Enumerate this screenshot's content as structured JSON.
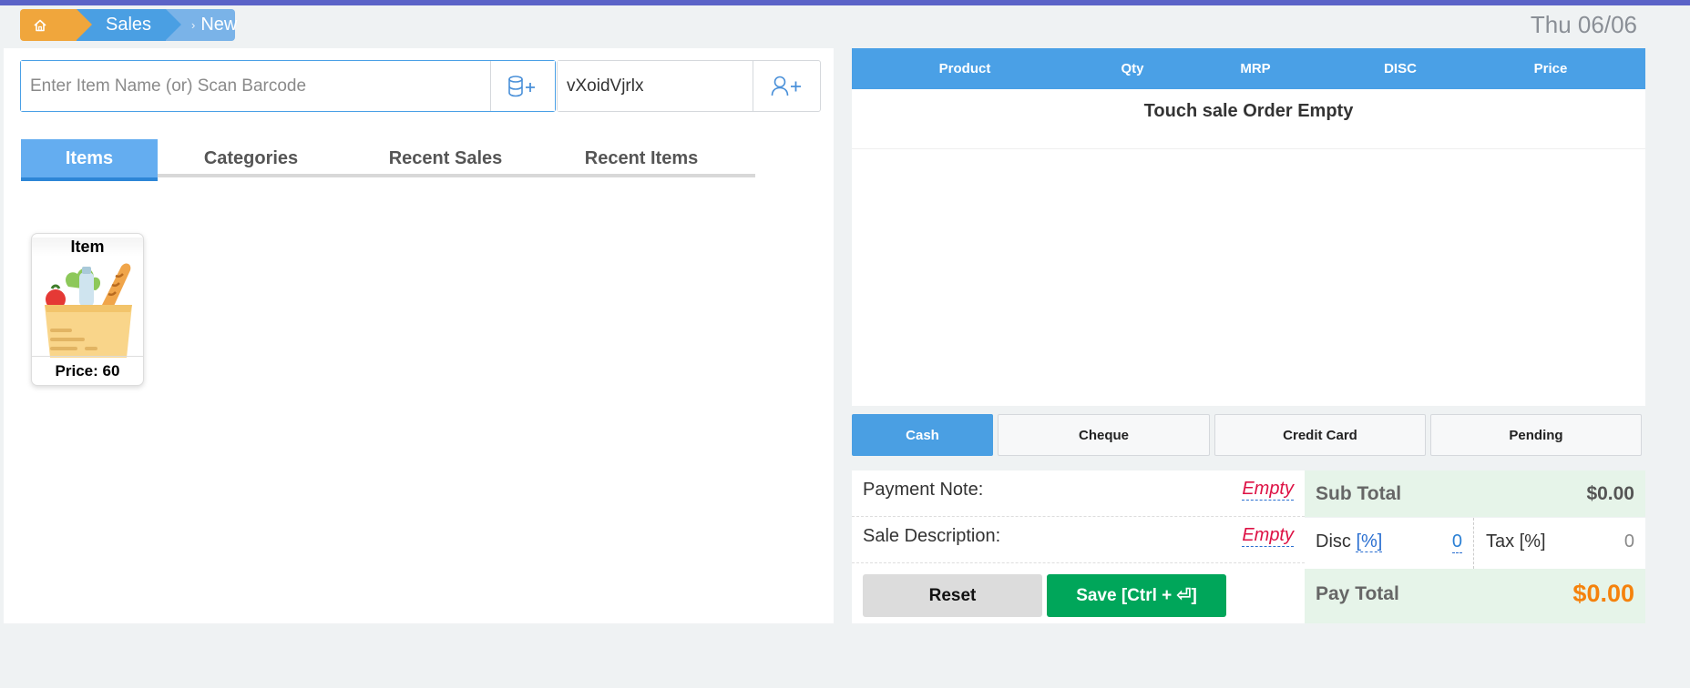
{
  "breadcrumb": {
    "sales": "Sales",
    "new": "New"
  },
  "header": {
    "date": "Thu 06/06"
  },
  "search": {
    "placeholder": "Enter Item Name (or) Scan Barcode",
    "value": ""
  },
  "customer": {
    "value": "vXoidVjrlx"
  },
  "tabs": [
    {
      "label": "Items",
      "active": true
    },
    {
      "label": "Categories",
      "active": false
    },
    {
      "label": "Recent Sales",
      "active": false
    },
    {
      "label": "Recent Items",
      "active": false
    }
  ],
  "items": [
    {
      "name": "Item",
      "price_label": "Price: 60"
    }
  ],
  "order": {
    "columns": [
      "Product",
      "Qty",
      "MRP",
      "DISC",
      "Price"
    ],
    "empty_message": "Touch sale Order Empty"
  },
  "payment_methods": [
    {
      "label": "Cash",
      "active": true
    },
    {
      "label": "Cheque",
      "active": false
    },
    {
      "label": "Credit Card",
      "active": false
    },
    {
      "label": "Pending",
      "active": false
    }
  ],
  "notes": {
    "payment_note_label": "Payment Note:",
    "payment_note_value": "Empty",
    "sale_description_label": "Sale Description:",
    "sale_description_value": "Empty"
  },
  "actions": {
    "reset": "Reset",
    "save": "Save [Ctrl + ⏎]"
  },
  "totals": {
    "subtotal_label": "Sub Total",
    "subtotal_value": "$0.00",
    "disc_label": "Disc",
    "disc_pct": "[%]",
    "disc_value": "0",
    "tax_label": "Tax [%]",
    "tax_value": "0",
    "paytotal_label": "Pay Total",
    "paytotal_value": "$0.00"
  },
  "colors": {
    "accent": "#4aa0e6",
    "save": "#00a65a",
    "home": "#f0a63c",
    "total": "#f5820d"
  }
}
